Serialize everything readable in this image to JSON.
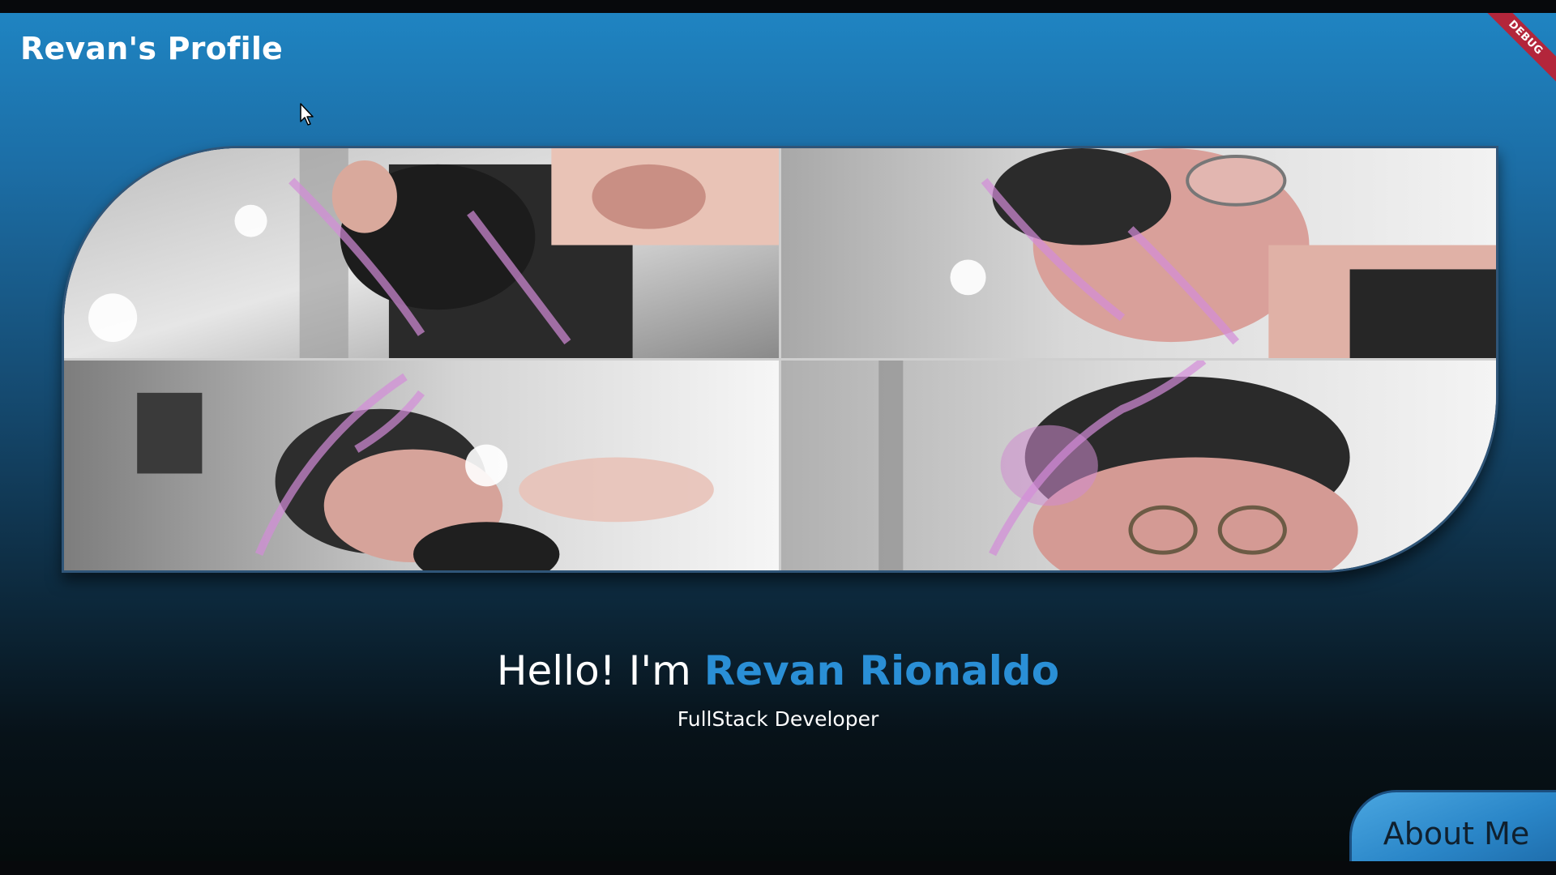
{
  "app": {
    "title": "Revan's Profile",
    "debug_label": "DEBUG"
  },
  "hero": {
    "greeting": "Hello! I'm",
    "name": "Revan Rionaldo",
    "role": "FullStack Developer"
  },
  "buttons": {
    "about_label": "About Me"
  },
  "photos": [
    {
      "alt": "selfie-top-left"
    },
    {
      "alt": "selfie-top-right"
    },
    {
      "alt": "selfie-bottom-left"
    },
    {
      "alt": "selfie-bottom-right"
    }
  ],
  "colors": {
    "accent": "#2a8fd6",
    "header_blue": "#1f84c2",
    "debug_red": "#b3263b"
  }
}
